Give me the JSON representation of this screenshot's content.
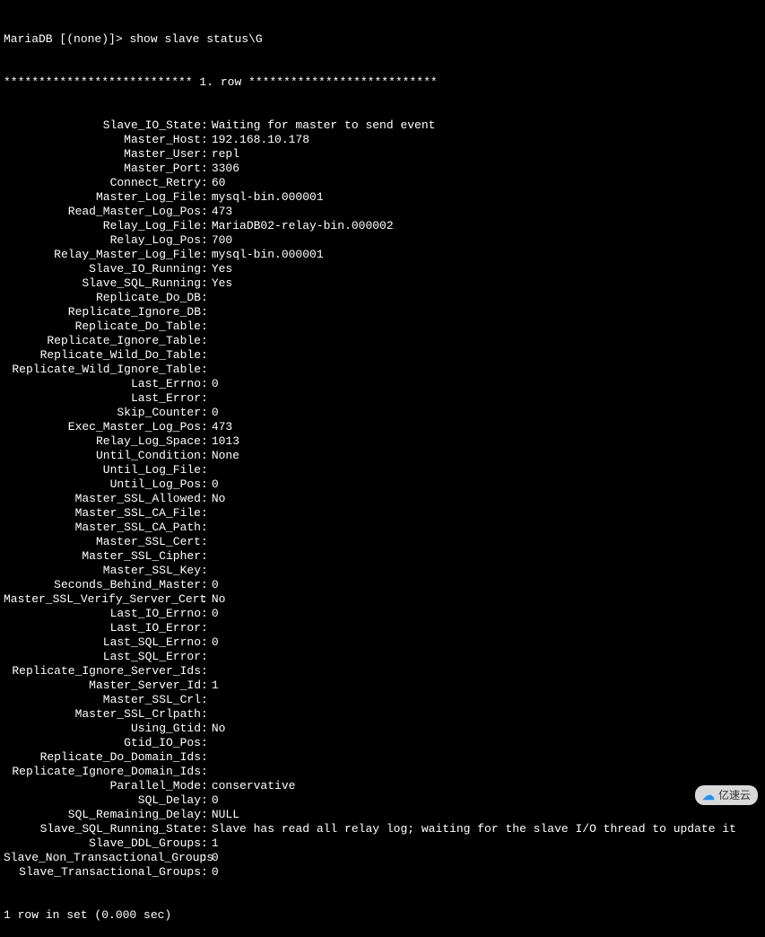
{
  "prompt": {
    "prefix": "MariaDB [(none)]>",
    "command": "show slave status\\G"
  },
  "row_header": "*************************** 1. row ***************************",
  "fields": [
    {
      "label": "Slave_IO_State",
      "value": "Waiting for master to send event"
    },
    {
      "label": "Master_Host",
      "value": "192.168.10.178"
    },
    {
      "label": "Master_User",
      "value": "repl"
    },
    {
      "label": "Master_Port",
      "value": "3306"
    },
    {
      "label": "Connect_Retry",
      "value": "60"
    },
    {
      "label": "Master_Log_File",
      "value": "mysql-bin.000001"
    },
    {
      "label": "Read_Master_Log_Pos",
      "value": "473"
    },
    {
      "label": "Relay_Log_File",
      "value": "MariaDB02-relay-bin.000002"
    },
    {
      "label": "Relay_Log_Pos",
      "value": "700"
    },
    {
      "label": "Relay_Master_Log_File",
      "value": "mysql-bin.000001"
    },
    {
      "label": "Slave_IO_Running",
      "value": "Yes"
    },
    {
      "label": "Slave_SQL_Running",
      "value": "Yes"
    },
    {
      "label": "Replicate_Do_DB",
      "value": ""
    },
    {
      "label": "Replicate_Ignore_DB",
      "value": ""
    },
    {
      "label": "Replicate_Do_Table",
      "value": ""
    },
    {
      "label": "Replicate_Ignore_Table",
      "value": ""
    },
    {
      "label": "Replicate_Wild_Do_Table",
      "value": ""
    },
    {
      "label": "Replicate_Wild_Ignore_Table",
      "value": ""
    },
    {
      "label": "Last_Errno",
      "value": "0"
    },
    {
      "label": "Last_Error",
      "value": ""
    },
    {
      "label": "Skip_Counter",
      "value": "0"
    },
    {
      "label": "Exec_Master_Log_Pos",
      "value": "473"
    },
    {
      "label": "Relay_Log_Space",
      "value": "1013"
    },
    {
      "label": "Until_Condition",
      "value": "None"
    },
    {
      "label": "Until_Log_File",
      "value": ""
    },
    {
      "label": "Until_Log_Pos",
      "value": "0"
    },
    {
      "label": "Master_SSL_Allowed",
      "value": "No"
    },
    {
      "label": "Master_SSL_CA_File",
      "value": ""
    },
    {
      "label": "Master_SSL_CA_Path",
      "value": ""
    },
    {
      "label": "Master_SSL_Cert",
      "value": ""
    },
    {
      "label": "Master_SSL_Cipher",
      "value": ""
    },
    {
      "label": "Master_SSL_Key",
      "value": ""
    },
    {
      "label": "Seconds_Behind_Master",
      "value": "0"
    },
    {
      "label": "Master_SSL_Verify_Server_Cert",
      "value": "No"
    },
    {
      "label": "Last_IO_Errno",
      "value": "0"
    },
    {
      "label": "Last_IO_Error",
      "value": ""
    },
    {
      "label": "Last_SQL_Errno",
      "value": "0"
    },
    {
      "label": "Last_SQL_Error",
      "value": ""
    },
    {
      "label": "Replicate_Ignore_Server_Ids",
      "value": ""
    },
    {
      "label": "Master_Server_Id",
      "value": "1"
    },
    {
      "label": "Master_SSL_Crl",
      "value": ""
    },
    {
      "label": "Master_SSL_Crlpath",
      "value": ""
    },
    {
      "label": "Using_Gtid",
      "value": "No"
    },
    {
      "label": "Gtid_IO_Pos",
      "value": ""
    },
    {
      "label": "Replicate_Do_Domain_Ids",
      "value": ""
    },
    {
      "label": "Replicate_Ignore_Domain_Ids",
      "value": ""
    },
    {
      "label": "Parallel_Mode",
      "value": "conservative"
    },
    {
      "label": "SQL_Delay",
      "value": "0"
    },
    {
      "label": "SQL_Remaining_Delay",
      "value": "NULL"
    },
    {
      "label": "Slave_SQL_Running_State",
      "value": "Slave has read all relay log; waiting for the slave I/O thread to update it"
    },
    {
      "label": "Slave_DDL_Groups",
      "value": "1"
    },
    {
      "label": "Slave_Non_Transactional_Groups",
      "value": "0"
    },
    {
      "label": "Slave_Transactional_Groups",
      "value": "0"
    }
  ],
  "footer": "1 row in set (0.000 sec)",
  "watermark": {
    "text": "亿速云"
  }
}
